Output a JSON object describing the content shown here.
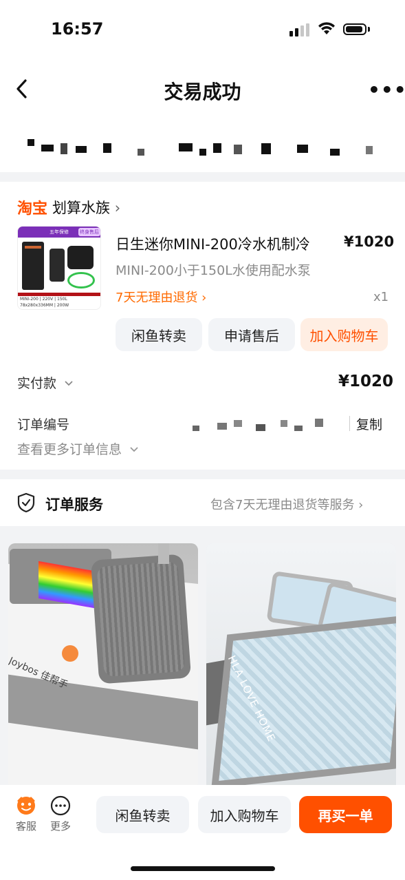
{
  "status_bar": {
    "time": "16:57"
  },
  "nav": {
    "title": "交易成功",
    "more": "•••"
  },
  "shop": {
    "logo_text": "淘宝",
    "name": "划算水族",
    "chevron": "›"
  },
  "product": {
    "title": "日生迷你MINI-200冷水机制冷",
    "price": "¥1020",
    "spec": "MINI-200小于150L水使用配水泵",
    "return_policy": "7天无理由退货 ›",
    "quantity": "x1",
    "thumb": {
      "tag_1": "五年保修",
      "tag_2": "终身售后",
      "row_1": "MINI-200 | 220V | 150L",
      "row_2": "78x280x336MM | 200W"
    }
  },
  "item_actions": [
    "闲鱼转卖",
    "申请售后",
    "加入购物车"
  ],
  "payment": {
    "label": "实付款",
    "amount": "¥1020"
  },
  "order": {
    "number_label": "订单编号",
    "copy_label": "复制",
    "more_info": "查看更多订单信息"
  },
  "service": {
    "title": "订单服务",
    "description": "包含7天无理由退货等服务 ›"
  },
  "recommendations": {
    "left_brand": "Joybos 佳帮手",
    "right_text": "HLA LOVE HOME"
  },
  "bottom_bar": {
    "tabs": [
      {
        "label": "客服"
      },
      {
        "label": "更多"
      }
    ],
    "buttons": [
      "闲鱼转卖",
      "加入购物车",
      "再买一单"
    ]
  },
  "colors": {
    "accent": "#ff5000",
    "button_bg": "#f2f4f7",
    "page_bg": "#f2f3f5"
  }
}
